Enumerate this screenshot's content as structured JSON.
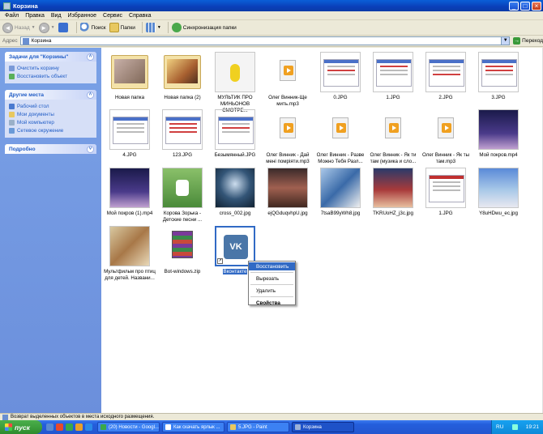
{
  "window": {
    "title": "Корзина"
  },
  "menu": [
    "Файл",
    "Правка",
    "Вид",
    "Избранное",
    "Сервис",
    "Справка"
  ],
  "toolbar": {
    "back": "Назад",
    "search": "Поиск",
    "folders": "Папки",
    "sync": "Синхронизация папки"
  },
  "address": {
    "label": "Адрес",
    "value": "Корзина",
    "go": "Переход"
  },
  "sidebar": {
    "tasks": {
      "title": "Задачи для \"Корзины\"",
      "items": [
        "Очистить корзину",
        "Восстановить объект"
      ]
    },
    "places": {
      "title": "Другие места",
      "items": [
        "Рабочий стол",
        "Мои документы",
        "Мой компьютер",
        "Сетевое окружение"
      ]
    },
    "details": {
      "title": "Подробно"
    }
  },
  "files": [
    "Новая папка",
    "Новая папка (2)",
    "МУЛЬТИК ПРО МИНЬОНОВ СМОТРЕ...",
    "Олег Винник-Ще мить.mp3",
    "0.JPG",
    "1.JPG",
    "2.JPG",
    "3.JPG",
    "4.JPG",
    "123.JPG",
    "Безымянный.JPG",
    "Олег Винник - Дай мені помріяти.mp3",
    "Олег Винник - Разве Можно Тебя Разл...",
    "Олег Винник - Як ти там (музика и сло...",
    "Олег Винник - Як ты там.mp3",
    "Мой покров.mp4",
    "Мой покров (1).mp4",
    "Корова Зорька - Детские песни ...",
    "cross_002.jpg",
    "ejQGduqvhpU.jpg",
    "7tsaB99yWh8.jpg",
    "TKRUoHZ_j3c.jpg",
    "1.JPG",
    "Y8uHDwu_ec.jpg",
    "Мультфильм про птиц для детей. Названи...",
    "Bot-windows.zip",
    "Вконтакте"
  ],
  "context_menu": [
    "Восстановить",
    "Вырезать",
    "Удалить",
    "Свойства"
  ],
  "status": "Возврат выделенных объектов в места исходного размещения.",
  "taskbar": {
    "start": "пуск",
    "tasks": [
      "(20) Новости - Googl...",
      "Как скачать ярлык ...",
      "5.JPG - Paint",
      "Корзина"
    ],
    "lang": "RU",
    "time": "19:21"
  }
}
